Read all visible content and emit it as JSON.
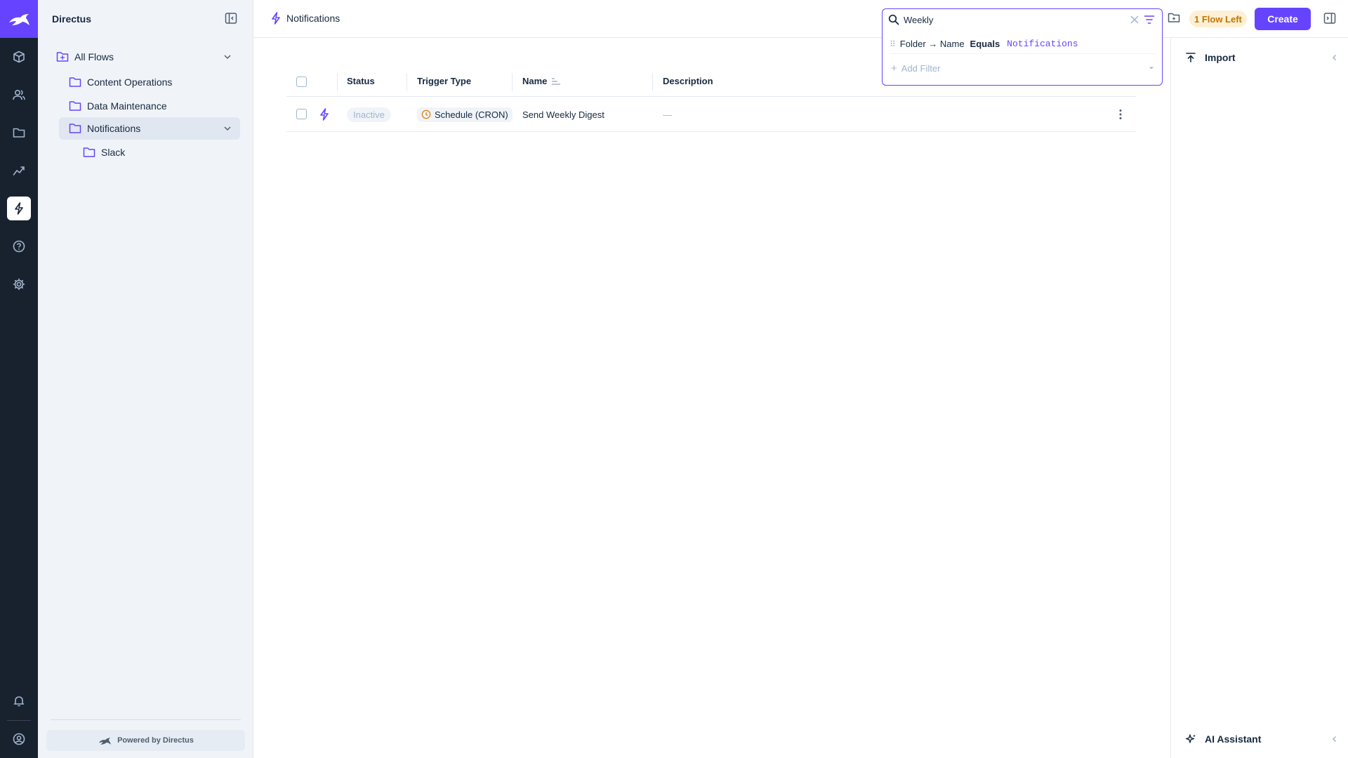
{
  "app": {
    "project_name": "Directus",
    "powered_by": "Powered by Directus"
  },
  "rail": {
    "items": [
      "content-icon",
      "users-icon",
      "files-icon",
      "insights-icon",
      "flows-icon",
      "help-icon",
      "settings-icon"
    ],
    "active": "flows-icon",
    "bottom": [
      "notifications-icon",
      "user-icon"
    ],
    "accent": "#6644ff"
  },
  "nav": {
    "tree": [
      {
        "label": "All Flows",
        "level": 0,
        "expanded": true
      },
      {
        "label": "Content Operations",
        "level": 1
      },
      {
        "label": "Data Maintenance",
        "level": 1
      },
      {
        "label": "Notifications",
        "level": 1,
        "active": true,
        "expanded": true
      },
      {
        "label": "Slack",
        "level": 2
      }
    ]
  },
  "header": {
    "title": "Notifications",
    "search_value": "Weekly",
    "filter": {
      "field": "Folder → Name",
      "operator": "Equals",
      "value": "Notifications"
    },
    "add_filter_label": "Add Filter",
    "flows_left_badge": "1 Flow Left",
    "create_label": "Create"
  },
  "table": {
    "columns": [
      "Status",
      "Trigger Type",
      "Name",
      "Description"
    ],
    "rows": [
      {
        "status": "Inactive",
        "trigger_type": "Schedule (CRON)",
        "name": "Send Weekly Digest",
        "description": "—"
      }
    ]
  },
  "sidebar": {
    "import_label": "Import",
    "ai_label": "AI Assistant"
  }
}
